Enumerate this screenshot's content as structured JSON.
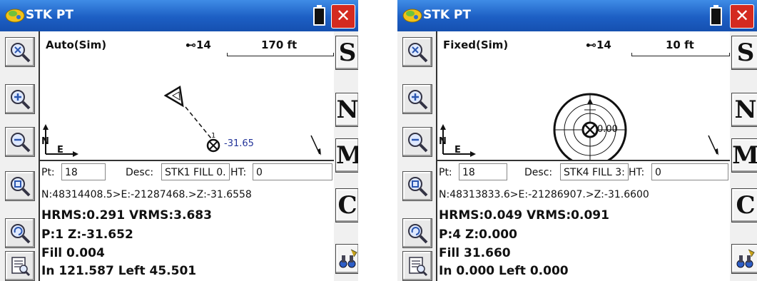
{
  "screens": [
    {
      "title": "STK PT",
      "close_label": "✕",
      "mode": "Auto(Sim)",
      "sats": "14",
      "scale": "170 ft",
      "elevation_label": "-31.65",
      "pt_label": "Pt:",
      "pt_value": "18",
      "desc_label": "Desc:",
      "desc_value": "STK1 FILL 0.",
      "ht_label": "HT:",
      "ht_value": "0",
      "coords": "N:48314408.5>E:-21287468.>Z:-31.6558",
      "rms": "HRMS:0.291 VRMS:3.683",
      "pz": "P:1 Z:-31.652",
      "fill": "Fill 0.004",
      "inleft": "In 121.587 Left 45.501",
      "buttons": [
        "S",
        "N",
        "M",
        "C"
      ]
    },
    {
      "title": "STK PT",
      "close_label": "✕",
      "mode": "Fixed(Sim)",
      "sats": "14",
      "scale": "10 ft",
      "elevation_label": "0.00",
      "pt_label": "Pt:",
      "pt_value": "18",
      "desc_label": "Desc:",
      "desc_value": "STK4 FILL 3:",
      "ht_label": "HT:",
      "ht_value": "0",
      "coords": "N:48313833.6>E:-21286907.>Z:-31.6600",
      "rms": "HRMS:0.049 VRMS:0.091",
      "pz": "P:4 Z:0.000",
      "fill": "Fill 31.660",
      "inleft": "In 0.000 Left 0.000",
      "buttons": [
        "S",
        "N",
        "M",
        "C"
      ]
    }
  ],
  "icons": {
    "toolbar": [
      "zoom-extents-icon",
      "zoom-in-icon",
      "zoom-out-icon",
      "zoom-window-icon",
      "zoom-previous-icon",
      "report-icon"
    ],
    "compass": "north-arrow-icon",
    "last_button": "binoculars-icon"
  },
  "colors": {
    "titlebar": "#1d5fc4",
    "close": "#d42a20",
    "elevation": "#223399"
  }
}
